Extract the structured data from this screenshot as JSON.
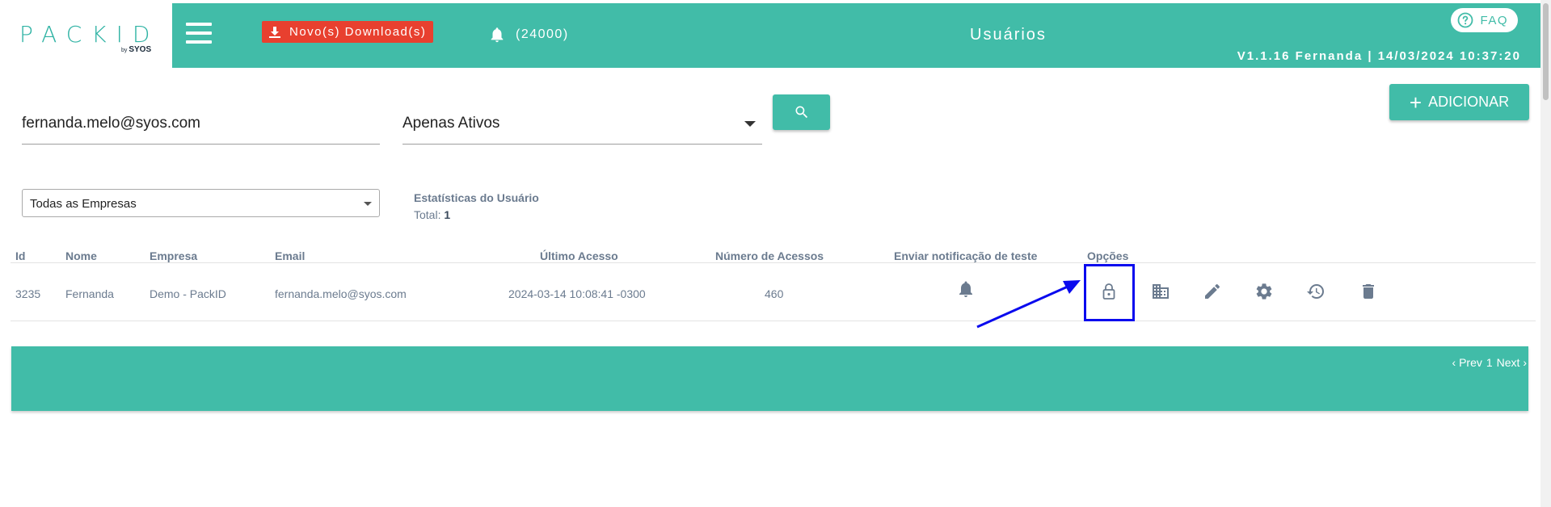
{
  "brand": {
    "logo": "PACKID",
    "logo_sub": "by SYOS"
  },
  "header": {
    "download_label": "Novo(s) Download(s)",
    "notification_count": "(24000)",
    "title": "Usuários",
    "faq_label": "FAQ",
    "version_line": "V1.1.16 Fernanda | 14/03/2024 10:37:20"
  },
  "filters": {
    "email_value": "fernanda.melo@syos.com",
    "status_selected": "Apenas Ativos",
    "company_selected": "Todas as Empresas",
    "add_label": "ADICIONAR"
  },
  "stats": {
    "title": "Estatísticas do Usuário",
    "total_label": "Total:",
    "total_value": "1"
  },
  "table": {
    "headers": [
      "Id",
      "Nome",
      "Empresa",
      "Email",
      "Último Acesso",
      "Número de Acessos",
      "Enviar notificação de teste",
      "Opções"
    ],
    "rows": [
      {
        "id": "3235",
        "nome": "Fernanda",
        "empresa": "Demo - PackID",
        "email": "fernanda.melo@syos.com",
        "ultimo_acesso": "2024-03-14 10:08:41 -0300",
        "acessos": "460"
      }
    ],
    "option_icons": [
      "lock-icon",
      "building-icon",
      "pencil-icon",
      "gear-icon",
      "history-icon",
      "trash-icon"
    ]
  },
  "pagination": {
    "prev": "‹ Prev",
    "page": "1",
    "next": "Next ›"
  },
  "colors": {
    "primary": "#41bca8",
    "download": "#e8402f",
    "text_muted": "#6b7b8f",
    "highlight": "#0a0aee"
  }
}
